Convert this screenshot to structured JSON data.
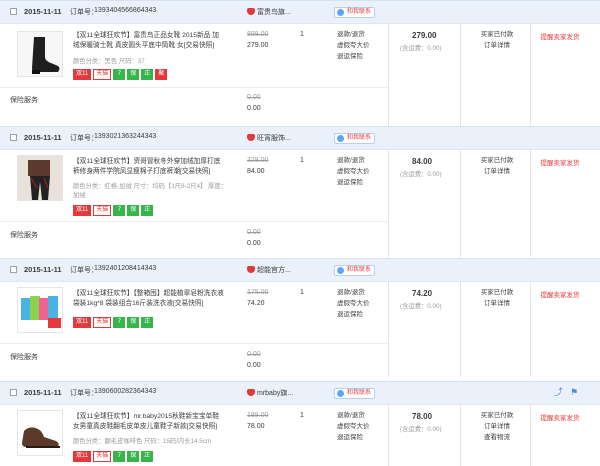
{
  "labels": {
    "order_no": "订单号：",
    "contact": "和我联系",
    "insurance": "保险服务",
    "shipping": "(含运费：0.00)",
    "status_paid": "买家已付款",
    "detail": "订单详情",
    "logistics": "查看物流",
    "remind": "提醒卖家发货",
    "svc1": "退款/退货",
    "svc2": "虚假夸大价",
    "svc3": "退运保险",
    "qty": "1",
    "ins_orig": "0.00",
    "ins_cur": "0.00"
  },
  "orders": [
    {
      "date": "2015-11-11",
      "order_no": "1393404566864343",
      "shop": "富贵鸟旗...",
      "title": "【双11全球狂欢节】富贵鸟正品女靴 2015新品 加绒保暖骑士靴 真皮圆头平底中筒靴 女[交易快照]",
      "attr": "颜色分类：黑色  尺码：37",
      "orig": "898.00",
      "cur": "279.00",
      "total": "279.00",
      "tags": [
        "双11",
        "天猫",
        "7",
        "保",
        "正",
        "聚"
      ]
    },
    {
      "date": "2015-11-11",
      "order_no": "1393021363244343",
      "shop": "旺宵服饰...",
      "title": "【双11全球狂欢节】资哥冒秋冬外穿加绒加厚打底裤修身两件学院风显瘦棉子打底裤潮[交易快照]",
      "attr": "颜色分类：红格-加绒  尺寸：均码【1尺8-2尺4】  厚度：加绒",
      "orig": "328.00",
      "cur": "84.00",
      "total": "84.00",
      "tags": [
        "双11",
        "天猫",
        "7",
        "保",
        "正"
      ]
    },
    {
      "date": "2015-11-11",
      "order_no": "1392401208414343",
      "shop": "超能官方...",
      "title": "【双11全球狂欢节】【整箱囤】超能植翠皂粉洗衣液袋装1kg*8 袋装组合16斤装洗衣液[交易快照]",
      "attr": "",
      "orig": "175.00",
      "cur": "74.20",
      "total": "74.20",
      "tags": [
        "双11",
        "天猫",
        "7",
        "保",
        "正"
      ]
    },
    {
      "date": "2015-11-11",
      "order_no": "1390600282364343",
      "shop": "mrbaby旗...",
      "title": "【双11全球狂欢节】mr.baby2015秋鞋新宝宝单鞋女男童真皮鞋翻毛皮单皮儿童鞋子新款[交易快照]",
      "attr": "颜色分类：翻毛皮咖啡色  尺码：15码/内长14.5cm",
      "orig": "188.00",
      "cur": "78.00",
      "total": "78.00",
      "tags": [
        "双11",
        "天猫",
        "7",
        "保",
        "正"
      ]
    }
  ]
}
